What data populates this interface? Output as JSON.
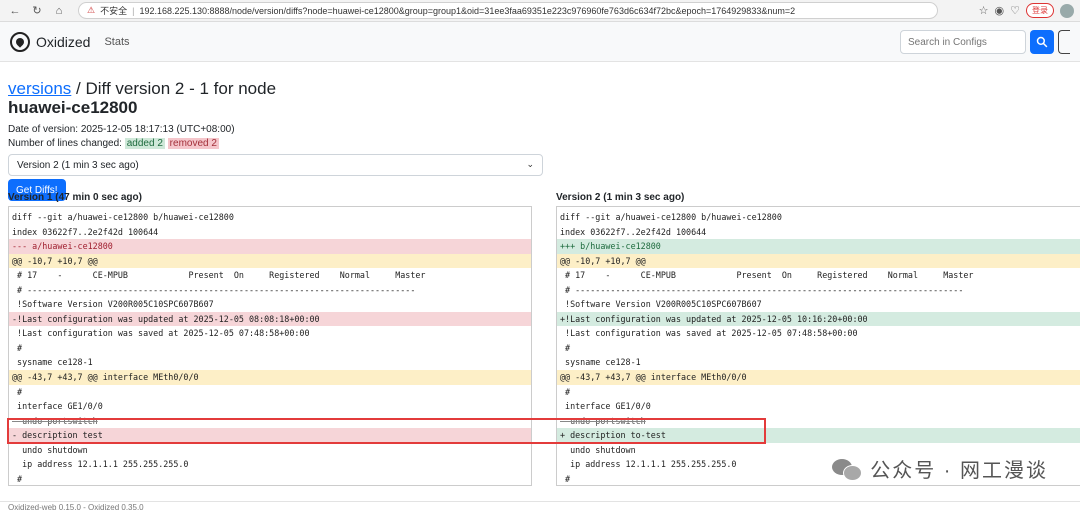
{
  "browser": {
    "insecure_label": "不安全",
    "url": "192.168.225.130:8888/node/version/diffs?node=huawei-ce12800&group=group1&oid=31ee3faa69351e223c976960fe763d6c634f72bc&epoch=1764929833&num=2",
    "login_label": "登录"
  },
  "navbar": {
    "brand": "Oxidized",
    "stats": "Stats",
    "search_placeholder": "Search in Configs"
  },
  "page": {
    "title_link": "versions",
    "title_text": " / Diff version 2 - 1 for node ",
    "node": "huawei-ce12800",
    "date_line": "Date of version: 2025-12-05 18:17:13 (UTC+08:00)",
    "lines_changed_label": "Number of lines changed: ",
    "added": "added 2",
    "removed": "removed 2",
    "select_value": "Version 2 (1 min 3 sec ago)",
    "get_diffs": "Get Diffs!"
  },
  "left": {
    "title": "Version 1 (47 min 0 sec ago)",
    "lines": [
      {
        "t": "diff --git a/huawei-ce12800 b/huawei-ce12800",
        "k": ""
      },
      {
        "t": "index 03622f7..2e2f42d 100644",
        "k": ""
      },
      {
        "t": "--- a/huawei-ce12800",
        "k": "rem-hdr"
      },
      {
        "t": "@@ -10,7 +10,7 @@",
        "k": "hunk"
      },
      {
        "t": " # 17    -      CE-MPUB            Present  On     Registered    Normal     Master",
        "k": ""
      },
      {
        "t": " # -----------------------------------------------------------------------------",
        "k": ""
      },
      {
        "t": " !Software Version V200R005C10SPC607B607",
        "k": ""
      },
      {
        "t": "-!Last configuration was updated at 2025-12-05 08:08:18+00:00",
        "k": "rem"
      },
      {
        "t": " !Last configuration was saved at 2025-12-05 07:48:58+00:00",
        "k": ""
      },
      {
        "t": " #",
        "k": ""
      },
      {
        "t": " sysname ce128-1",
        "k": ""
      },
      {
        "t": "@@ -43,7 +43,7 @@ interface MEth0/0/0",
        "k": "hunk"
      },
      {
        "t": " #",
        "k": ""
      },
      {
        "t": " interface GE1/0/0",
        "k": ""
      },
      {
        "t": "  undo portswitch",
        "k": "strike"
      },
      {
        "t": "- description test",
        "k": "rem"
      },
      {
        "t": "  undo shutdown",
        "k": ""
      },
      {
        "t": "  ip address 12.1.1.1 255.255.255.0",
        "k": ""
      },
      {
        "t": " #",
        "k": ""
      }
    ]
  },
  "right": {
    "title": "Version 2 (1 min 3 sec ago)",
    "lines": [
      {
        "t": "diff --git a/huawei-ce12800 b/huawei-ce12800",
        "k": ""
      },
      {
        "t": "index 03622f7..2e2f42d 100644",
        "k": ""
      },
      {
        "t": "+++ b/huawei-ce12800",
        "k": "add-hdr"
      },
      {
        "t": "@@ -10,7 +10,7 @@",
        "k": "hunk"
      },
      {
        "t": " # 17    -      CE-MPUB            Present  On     Registered    Normal     Master",
        "k": ""
      },
      {
        "t": " # -----------------------------------------------------------------------------",
        "k": ""
      },
      {
        "t": " !Software Version V200R005C10SPC607B607",
        "k": ""
      },
      {
        "t": "+!Last configuration was updated at 2025-12-05 10:16:20+00:00",
        "k": "add"
      },
      {
        "t": " !Last configuration was saved at 2025-12-05 07:48:58+00:00",
        "k": ""
      },
      {
        "t": " #",
        "k": ""
      },
      {
        "t": " sysname ce128-1",
        "k": ""
      },
      {
        "t": "@@ -43,7 +43,7 @@ interface MEth0/0/0",
        "k": "hunk"
      },
      {
        "t": " #",
        "k": ""
      },
      {
        "t": " interface GE1/0/0",
        "k": ""
      },
      {
        "t": "  undo portswitch",
        "k": "strike"
      },
      {
        "t": "+ description to-test",
        "k": "add"
      },
      {
        "t": "  undo shutdown",
        "k": ""
      },
      {
        "t": "  ip address 12.1.1.1 255.255.255.0",
        "k": ""
      },
      {
        "t": " #",
        "k": ""
      }
    ]
  },
  "watermark": "公众号 · 网工漫谈",
  "footer": "Oxidized-web 0.15.0 - Oxidized 0.35.0"
}
